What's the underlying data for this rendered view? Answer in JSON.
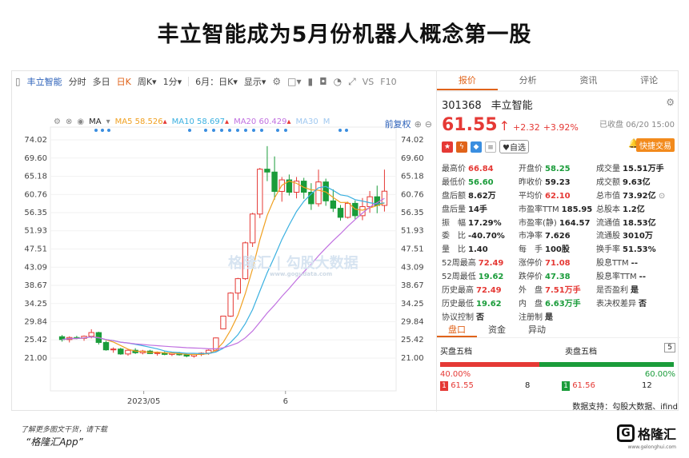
{
  "headline": "丰立智能成为5月份机器人概念第一股",
  "toolbar": {
    "stock_name": "丰立智能",
    "items": [
      "分时",
      "多日",
      "日K",
      "周K",
      "1分",
      "6月",
      "日K",
      "显示"
    ],
    "vs": "VS",
    "f10": "F10"
  },
  "chart_overlay": {
    "ma_label": "MA",
    "ma5": "MA5",
    "ma5_val": "58.526",
    "ma10": "MA10",
    "ma10_val": "58.697",
    "ma20": "MA20",
    "ma20_val": "60.429",
    "ma30": "MA30",
    "ma_extra": "M",
    "fq": "前复权"
  },
  "colors": {
    "up": "#e53935",
    "down": "#1a9c3a",
    "ma5": "#f0a020",
    "ma10": "#3ab0e0",
    "ma20": "#c070e0",
    "ma30": "#a0c8f0",
    "accent": "#e0631a"
  },
  "chart_data": {
    "type": "candlestick",
    "y_ticks": [
      "74.02",
      "69.60",
      "65.18",
      "60.76",
      "56.35",
      "51.93",
      "47.51",
      "43.09",
      "38.67",
      "34.25",
      "29.84",
      "25.42",
      "21.00"
    ],
    "x_labels": [
      "2023/05",
      "6"
    ],
    "ylim": [
      21.0,
      74.02
    ],
    "candles": [
      [
        26.2,
        26.6,
        25.0,
        25.5
      ],
      [
        25.5,
        26.3,
        24.8,
        26.0
      ],
      [
        26.0,
        26.4,
        25.6,
        25.8
      ],
      [
        25.8,
        26.5,
        25.2,
        26.3
      ],
      [
        26.3,
        28.0,
        25.8,
        27.2
      ],
      [
        27.2,
        27.4,
        24.3,
        24.8
      ],
      [
        24.8,
        25.2,
        22.8,
        23.0
      ],
      [
        23.0,
        23.6,
        22.3,
        23.2
      ],
      [
        23.2,
        23.5,
        21.8,
        22.0
      ],
      [
        22.0,
        23.1,
        21.6,
        22.9
      ],
      [
        22.9,
        23.4,
        22.0,
        22.3
      ],
      [
        22.3,
        23.0,
        21.9,
        22.7
      ],
      [
        22.7,
        23.0,
        22.0,
        22.1
      ],
      [
        22.1,
        22.6,
        21.6,
        22.3
      ],
      [
        22.3,
        22.6,
        21.7,
        21.9
      ],
      [
        21.9,
        22.4,
        21.5,
        22.2
      ],
      [
        22.2,
        22.5,
        21.6,
        21.8
      ],
      [
        21.8,
        22.2,
        21.2,
        21.5
      ],
      [
        21.5,
        22.0,
        21.1,
        21.9
      ],
      [
        21.9,
        22.4,
        21.5,
        22.2
      ],
      [
        22.2,
        23.1,
        21.8,
        22.9
      ],
      [
        22.9,
        26.0,
        22.5,
        25.9
      ],
      [
        28.1,
        31.3,
        28.0,
        31.2
      ],
      [
        31.2,
        37.0,
        31.0,
        36.8
      ],
      [
        36.8,
        40.5,
        35.2,
        40.3
      ],
      [
        40.3,
        49.3,
        40.0,
        49.0
      ],
      [
        49.0,
        56.3,
        48.0,
        56.0
      ],
      [
        56.0,
        67.2,
        55.0,
        66.9
      ],
      [
        66.9,
        72.5,
        64.0,
        66.2
      ],
      [
        66.2,
        70.0,
        59.5,
        61.5
      ],
      [
        61.5,
        65.0,
        59.0,
        64.3
      ],
      [
        64.3,
        65.6,
        60.5,
        61.3
      ],
      [
        61.3,
        65.0,
        59.8,
        64.0
      ],
      [
        64.0,
        64.8,
        59.7,
        61.3
      ],
      [
        61.3,
        63.5,
        57.0,
        58.5
      ],
      [
        58.5,
        66.8,
        57.8,
        63.8
      ],
      [
        63.8,
        64.6,
        58.0,
        59.2
      ],
      [
        59.2,
        62.0,
        56.5,
        57.4
      ],
      [
        57.4,
        58.2,
        54.4,
        55.2
      ],
      [
        55.2,
        59.0,
        54.9,
        58.6
      ],
      [
        58.6,
        59.3,
        54.8,
        55.6
      ],
      [
        55.6,
        59.9,
        54.5,
        57.8
      ],
      [
        57.8,
        61.6,
        56.3,
        60.2
      ],
      [
        60.2,
        62.9,
        56.2,
        58.1
      ],
      [
        58.1,
        66.8,
        56.6,
        61.55
      ]
    ]
  },
  "watermark": {
    "brand": "格隆汇",
    "site": "勾股大数据",
    "url": "www.gogudata.com"
  },
  "tabs": [
    "报价",
    "分析",
    "资讯",
    "评论"
  ],
  "stock": {
    "code": "301368",
    "name": "丰立智能",
    "price": "61.55",
    "change": "+2.32",
    "pct": "+3.92%",
    "status": "已收盘 06/20 15:00",
    "watch": "自选",
    "trade": "快捷交易"
  },
  "quote_rows": [
    [
      [
        "最高价",
        "66.84",
        "red"
      ],
      [
        "开盘价",
        "58.25",
        "green"
      ],
      [
        "成交量",
        "15.51万手",
        "dark"
      ]
    ],
    [
      [
        "最低价",
        "56.60",
        "green"
      ],
      [
        "昨收价",
        "59.23",
        "dark"
      ],
      [
        "成交额",
        "9.63亿",
        "dark"
      ]
    ],
    [
      [
        "盘后额",
        "8.62万",
        "dark"
      ],
      [
        "平均价",
        "62.10",
        "red"
      ],
      [
        "总市值",
        "73.92亿",
        "dark"
      ]
    ],
    [
      [
        "盘后量",
        "14手",
        "dark"
      ],
      [
        "市盈率TTM",
        "185.95",
        "dark"
      ],
      [
        "总股本",
        "1.2亿",
        "dark"
      ]
    ],
    [
      [
        "振　幅",
        "17.29%",
        "dark"
      ],
      [
        "市盈率(静)",
        "164.57",
        "dark"
      ],
      [
        "流通值",
        "18.53亿",
        "dark"
      ]
    ],
    [
      [
        "委　比",
        "-40.70%",
        "dark"
      ],
      [
        "市净率",
        "7.626",
        "dark"
      ],
      [
        "流通股",
        "3010万",
        "dark"
      ]
    ],
    [
      [
        "量　比",
        "1.40",
        "dark"
      ],
      [
        "每　手",
        "100股",
        "dark"
      ],
      [
        "换手率",
        "51.53%",
        "dark"
      ]
    ],
    [
      [
        "52周最高",
        "72.49",
        "red"
      ],
      [
        "涨停价",
        "71.08",
        "red"
      ],
      [
        "股息TTM",
        "--",
        "dark"
      ]
    ],
    [
      [
        "52周最低",
        "19.62",
        "green"
      ],
      [
        "跌停价",
        "47.38",
        "green"
      ],
      [
        "股息率TTM",
        "--",
        "dark"
      ]
    ],
    [
      [
        "历史最高",
        "72.49",
        "red"
      ],
      [
        "外　盘",
        "7.51万手",
        "red"
      ],
      [
        "是否盈利",
        "是",
        "dark"
      ]
    ],
    [
      [
        "历史最低",
        "19.62",
        "green"
      ],
      [
        "内　盘",
        "6.63万手",
        "green"
      ],
      [
        "表决权差异",
        "否",
        "dark"
      ]
    ],
    [
      [
        "协议控制",
        "否",
        "dark"
      ],
      [
        "注册制",
        "是",
        "dark"
      ],
      [
        "",
        "",
        ""
      ]
    ]
  ],
  "subtabs": [
    "盘口",
    "资金",
    "异动"
  ],
  "book": {
    "buy_title": "买盘五档",
    "sell_title": "卖盘五档",
    "count": "5",
    "buy_pct": "40.00%",
    "sell_pct": "60.00%",
    "buy_level": "1",
    "buy_price": "61.55",
    "buy_qty": "8",
    "sell_level": "1",
    "sell_price": "61.56",
    "sell_qty": "12"
  },
  "footer": {
    "support": "数据支持：勾股大数据、ifind",
    "tip": "了解更多图文干货，请下载",
    "app": "“格隆汇App”",
    "logo": "格隆汇",
    "logo_sub": "www.gelonghui.com"
  }
}
